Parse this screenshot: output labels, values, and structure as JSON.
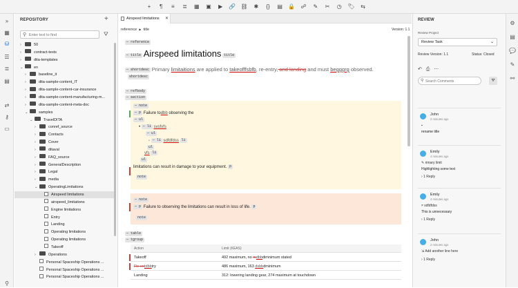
{
  "toolbar": {
    "icons": [
      "plus-icon",
      "paragraph-icon",
      "ordered-list-icon",
      "unordered-list-icon",
      "table-icon",
      "image-icon",
      "media-icon",
      "link-icon",
      "unlink-icon",
      "snippet-icon",
      "braces-icon",
      "code-block-icon",
      "lock-icon",
      "conref-icon",
      "pen-icon",
      "cut-icon",
      "history-icon",
      "tag-icon",
      "track-changes-icon"
    ],
    "glyphs": [
      "+",
      "¶",
      "≡",
      "≣",
      "▦",
      "▣",
      "▶",
      "🔗",
      "⛓",
      "✱",
      "{}",
      "▤",
      "🔒",
      "☍",
      "✎",
      "✂",
      "◷",
      "🏷",
      "⇆"
    ]
  },
  "leftrail": {
    "items": [
      {
        "name": "collapse-icon",
        "glyph": "»"
      },
      {
        "name": "grid-icon",
        "glyph": "▦"
      },
      {
        "name": "repository-icon",
        "glyph": "⛁"
      },
      {
        "name": "outline-icon",
        "glyph": "☰"
      },
      {
        "name": "list-icon",
        "glyph": "≣"
      },
      {
        "name": "file-list-icon",
        "glyph": "▤"
      },
      {
        "name": "compare-icon",
        "glyph": "⇄"
      },
      {
        "name": "key-icon",
        "glyph": "⚷"
      },
      {
        "name": "tablet-icon",
        "glyph": "▭"
      },
      {
        "name": "find-icon",
        "glyph": "⚲"
      }
    ]
  },
  "repo": {
    "title": "REPOSITORY",
    "add": "+",
    "search_placeholder": "Enter text to find",
    "tree": [
      {
        "label": "50",
        "depth": 0,
        "type": "folder",
        "open": false
      },
      {
        "label": "contract-tests",
        "depth": 0,
        "type": "folder",
        "open": false
      },
      {
        "label": "dita-templates",
        "depth": 0,
        "type": "folder",
        "open": false
      },
      {
        "label": "en",
        "depth": 0,
        "type": "folder",
        "open": true
      },
      {
        "label": "baseline_it",
        "depth": 1,
        "type": "folder",
        "open": false
      },
      {
        "label": "dita-sample-content_IT",
        "depth": 1,
        "type": "folder",
        "open": false
      },
      {
        "label": "dita-sample-content-car-insurance",
        "depth": 1,
        "type": "folder",
        "open": false
      },
      {
        "label": "dita-sample-content-manufacturing-m...",
        "depth": 1,
        "type": "folder",
        "open": false
      },
      {
        "label": "dita-sample-content-meta-doc",
        "depth": 1,
        "type": "folder",
        "open": false
      },
      {
        "label": "samples",
        "depth": 1,
        "type": "folder",
        "open": true
      },
      {
        "label": "TravelDITA",
        "depth": 2,
        "type": "folder",
        "open": true
      },
      {
        "label": "conref_source",
        "depth": 3,
        "type": "folder",
        "open": false
      },
      {
        "label": "Contacts",
        "depth": 3,
        "type": "folder",
        "open": false
      },
      {
        "label": "Cover",
        "depth": 3,
        "type": "folder",
        "open": false
      },
      {
        "label": "ditaval",
        "depth": 3,
        "type": "folder",
        "open": false
      },
      {
        "label": "FAQ_source",
        "depth": 3,
        "type": "folder",
        "open": false
      },
      {
        "label": "GeneralDescription",
        "depth": 3,
        "type": "folder",
        "open": false
      },
      {
        "label": "Legal",
        "depth": 3,
        "type": "folder",
        "open": false
      },
      {
        "label": "media",
        "depth": 3,
        "type": "folder",
        "open": false
      },
      {
        "label": "OperatingLimitations",
        "depth": 3,
        "type": "folder",
        "open": true
      },
      {
        "label": "Airspeed limitations",
        "depth": 4,
        "type": "doc",
        "selected": true
      },
      {
        "label": "airspeed_limitations",
        "depth": 4,
        "type": "doc"
      },
      {
        "label": "Engine limitations",
        "depth": 4,
        "type": "doc"
      },
      {
        "label": "Entry",
        "depth": 4,
        "type": "doc"
      },
      {
        "label": "Landing",
        "depth": 4,
        "type": "doc"
      },
      {
        "label": "Operating limitations",
        "depth": 4,
        "type": "doc"
      },
      {
        "label": "Operating limitations",
        "depth": 4,
        "type": "doc"
      },
      {
        "label": "Takeoff",
        "depth": 4,
        "type": "doc"
      },
      {
        "label": "Operations",
        "depth": 3,
        "type": "folder",
        "open": false
      },
      {
        "label": "Personal Spaceship Operations ...",
        "depth": 3,
        "type": "doc"
      },
      {
        "label": "Personal Spaceship Operations ...",
        "depth": 3,
        "type": "doc"
      },
      {
        "label": "Personal Spaceship Operations ...",
        "depth": 3,
        "type": "doc"
      }
    ]
  },
  "editor": {
    "tab_label": "Airspeed limitations",
    "tab_close": "✕",
    "breadcrumb": [
      "reference",
      "title"
    ],
    "breadcrumb_sep": "▶",
    "version": "Version: 1.1",
    "tags": {
      "reference": "reference",
      "title": "title",
      "shortdesc": "shortdesc",
      "refbody": "refbody",
      "section": "section",
      "note": "note",
      "p": "p",
      "ul": "ul",
      "li": "li",
      "table": "table",
      "tgroup": "tgroup"
    },
    "title_text": "Airspeed limitations",
    "shortdesc": {
      "a": "Primary ",
      "b": "limitaitions",
      "c": " are applied to ",
      "d": "takeoff",
      "e": "fsbfb",
      "f": ", re-entry,",
      "g": " and landing",
      "h": " and must ",
      "i": "begggrg",
      "j": " observed."
    },
    "note1": {
      "p_a": "Failure to",
      "p_b": "dbb",
      "p_c": " observing the",
      "li1": "svsfvfs",
      "li2": "sdfdfdss",
      "li3": "vfs",
      "text": "limitations can result in damage to your equipment."
    },
    "note2": {
      "text": "Failure to observing the limitations can result in loss of life."
    },
    "table": {
      "headers": [
        "Action",
        "Limit (KEAS)"
      ],
      "rows": [
        {
          "a": "Takeoff",
          "b": "492 maximum, no ",
          "b2": "m",
          "b3": "dbb",
          "b4": "dimnimum stated"
        },
        {
          "a": "Re-entry",
          "a_del": "Re-en",
          "a_ins": "tdbb",
          "a_end": "try",
          "b": "486 maximum, 163 ",
          "b2": "dsbb",
          "b3": "dminimum"
        },
        {
          "a": "Landing",
          "b": "312: lowering landing gear, 274 maximum at touchdown"
        }
      ]
    }
  },
  "review": {
    "title": "REVIEW",
    "project_label": "Review Project",
    "project_value": "Review Task",
    "version": "Review Version: 1.1",
    "status": "Status: Closed",
    "search_placeholder": "Search Comments",
    "comments": [
      {
        "name": "John",
        "time": "2 minutes ago",
        "ref": "",
        "text": "rename title",
        "reply": ""
      },
      {
        "name": "Emily",
        "time": "4 minutes ago",
        "ref": "rimary limit",
        "text": "Highlighting some text",
        "reply": "1 Reply"
      },
      {
        "name": "Emily",
        "time": "4 minutes ago",
        "ref": "sdfdfdss",
        "text": "This is unnecessary",
        "reply": "1 Reply"
      },
      {
        "name": "John",
        "time": "2 minutes ago",
        "ref": "",
        "text": "Add another line here",
        "reply": "1 Reply"
      }
    ]
  },
  "rightrail": {
    "items": [
      {
        "name": "settings-icon",
        "glyph": "⚙"
      },
      {
        "name": "document-icon",
        "glyph": "▤"
      },
      {
        "name": "comment-icon",
        "glyph": "💬"
      },
      {
        "name": "brush-icon",
        "glyph": "✎"
      },
      {
        "name": "share-icon",
        "glyph": "⚯"
      }
    ]
  },
  "colors": {
    "accent": "#1473e6",
    "note": "#fff7e0",
    "warning": "#fde7d9",
    "avatar": "#45aee7",
    "deleted": "#d23a3a",
    "inserted": "#4caf50"
  }
}
